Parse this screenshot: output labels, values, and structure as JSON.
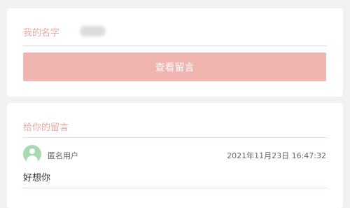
{
  "name_section": {
    "label": "我的名字",
    "value_hidden": true
  },
  "view_button": {
    "label": "查看留言"
  },
  "messages_section": {
    "title": "给你的留言",
    "messages": [
      {
        "user": "匿名用户",
        "timestamp": "2021年11月23日 16:47:32",
        "text": "好想你",
        "avatar_icon": "user-avatar-icon"
      }
    ]
  },
  "colors": {
    "accent": "#f0b5b0",
    "label": "#e6a9a2",
    "avatar_bg": "#a9d8b2"
  }
}
